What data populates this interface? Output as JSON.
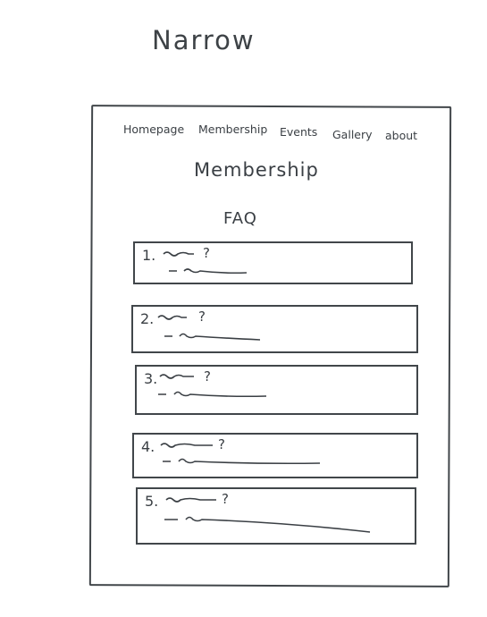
{
  "window": {
    "title": "Narrow"
  },
  "nav": {
    "items": [
      {
        "label": "Homepage"
      },
      {
        "label": "Membership"
      },
      {
        "label": "Events"
      },
      {
        "label": "Gallery"
      },
      {
        "label": "about"
      }
    ]
  },
  "page": {
    "heading": "Membership",
    "section_title": "FAQ"
  },
  "faq": {
    "items": [
      {
        "number": "1."
      },
      {
        "number": "2."
      },
      {
        "number": "3."
      },
      {
        "number": "4."
      },
      {
        "number": "5."
      }
    ]
  },
  "colors": {
    "ink": "#3a3f44",
    "background": "#ffffff"
  }
}
